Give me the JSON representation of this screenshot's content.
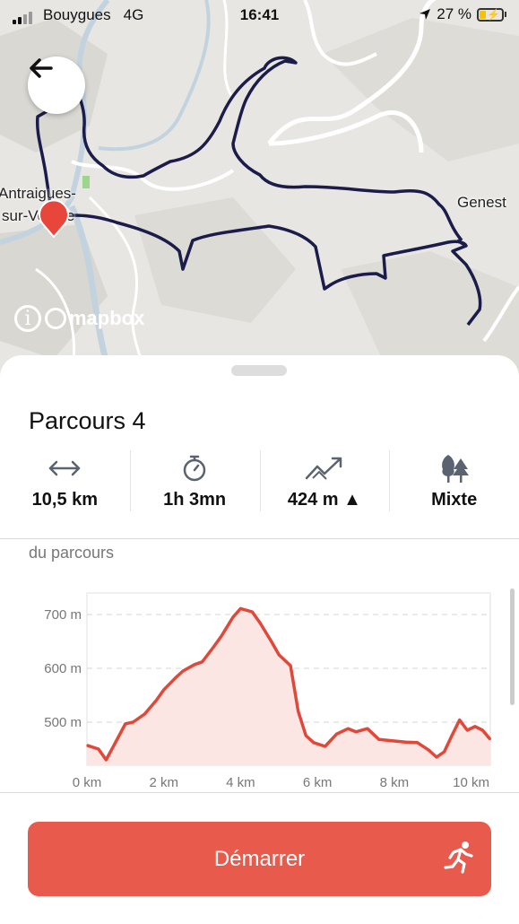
{
  "status_bar": {
    "carrier": "Bouygues",
    "network": "4G",
    "time": "16:41",
    "battery": "27 %"
  },
  "map": {
    "labels": {
      "town1_line1": "Antraigues-",
      "town1_line2": "sur-Volane",
      "town2": "Genest"
    },
    "attribution": "mapbox",
    "info_glyph": "i",
    "icons": {
      "back": "arrow-left-icon",
      "start_pin": "location-pin-icon"
    }
  },
  "route": {
    "title": "Parcours 4",
    "stats": [
      {
        "icon": "distance-arrows-icon",
        "value": "10,5 km"
      },
      {
        "icon": "stopwatch-icon",
        "value": "1h 3mn"
      },
      {
        "icon": "elevation-trend-icon",
        "value": "424 m ▲"
      },
      {
        "icon": "trees-icon",
        "value": "Mixte"
      }
    ],
    "profile_subtitle": "du parcours"
  },
  "chart_data": {
    "type": "area",
    "x_unit": "km",
    "y_unit": "m",
    "xlim": [
      0,
      10.5
    ],
    "ylim": [
      420,
      740
    ],
    "xticks": [
      "0 km",
      "2 km",
      "4 km",
      "6 km",
      "8 km",
      "10 km"
    ],
    "yticks": [
      "500 m",
      "600 m",
      "700 m"
    ],
    "xtick_values": [
      0,
      2,
      4,
      6,
      8,
      10
    ],
    "ytick_values": [
      500,
      600,
      700
    ],
    "x": [
      0,
      0.3,
      0.5,
      0.8,
      1.0,
      1.2,
      1.5,
      1.8,
      2.0,
      2.3,
      2.5,
      2.8,
      3.0,
      3.3,
      3.5,
      3.8,
      4.0,
      4.3,
      4.5,
      4.8,
      5.0,
      5.3,
      5.5,
      5.7,
      5.9,
      6.2,
      6.5,
      6.8,
      7.0,
      7.3,
      7.6,
      8.0,
      8.3,
      8.6,
      8.9,
      9.1,
      9.3,
      9.5,
      9.7,
      9.9,
      10.1,
      10.3,
      10.5
    ],
    "y": [
      457,
      450,
      430,
      470,
      497,
      500,
      515,
      540,
      560,
      582,
      595,
      607,
      612,
      640,
      660,
      695,
      711,
      705,
      685,
      650,
      625,
      605,
      520,
      475,
      462,
      455,
      478,
      488,
      482,
      488,
      468,
      465,
      463,
      462,
      448,
      435,
      445,
      475,
      504,
      485,
      492,
      485,
      468
    ],
    "line_color": "#e0483a",
    "fill_color": "#fbe6e3",
    "grid": true
  },
  "actions": {
    "start_label": "Démarrer"
  },
  "colors": {
    "accent": "#e85a4b",
    "route": "#1b1c4a",
    "pin": "#e8463b"
  }
}
